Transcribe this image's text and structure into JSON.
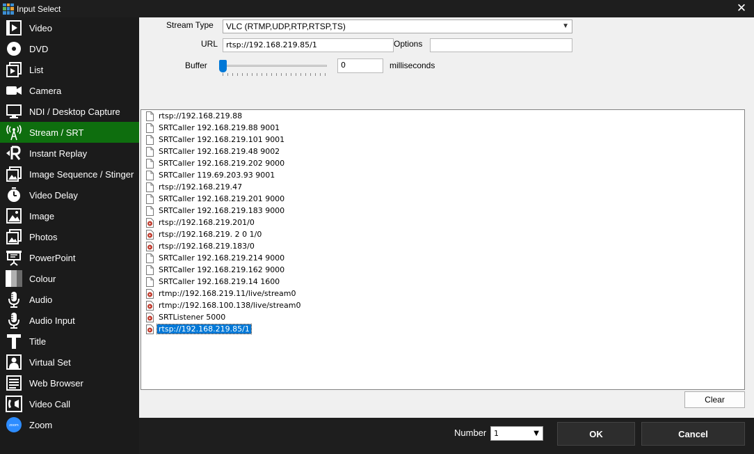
{
  "window": {
    "title": "Input Select"
  },
  "sidebar": {
    "items": [
      {
        "label": "Video",
        "icon": "video-icon"
      },
      {
        "label": "DVD",
        "icon": "dvd-icon"
      },
      {
        "label": "List",
        "icon": "list-icon"
      },
      {
        "label": "Camera",
        "icon": "camera-icon"
      },
      {
        "label": "NDI / Desktop Capture",
        "icon": "monitor-icon"
      },
      {
        "label": "Stream / SRT",
        "icon": "antenna-icon",
        "active": true
      },
      {
        "label": "Instant Replay",
        "icon": "replay-icon"
      },
      {
        "label": "Image Sequence / Stinger",
        "icon": "image-sequence-icon"
      },
      {
        "label": "Video Delay",
        "icon": "timer-icon"
      },
      {
        "label": "Image",
        "icon": "image-icon"
      },
      {
        "label": "Photos",
        "icon": "photos-icon"
      },
      {
        "label": "PowerPoint",
        "icon": "presentation-icon"
      },
      {
        "label": "Colour",
        "icon": "colour-icon"
      },
      {
        "label": "Audio",
        "icon": "microphone-icon"
      },
      {
        "label": "Audio Input",
        "icon": "microphone-icon"
      },
      {
        "label": "Title",
        "icon": "title-icon"
      },
      {
        "label": "Virtual Set",
        "icon": "virtual-set-icon"
      },
      {
        "label": "Web Browser",
        "icon": "web-browser-icon"
      },
      {
        "label": "Video Call",
        "icon": "video-call-icon"
      },
      {
        "label": "Zoom",
        "icon": "zoom-icon"
      }
    ]
  },
  "form": {
    "stream_type_label": "Stream Type",
    "stream_type_value": "VLC (RTMP,UDP,RTP,RTSP,TS)",
    "url_label": "URL",
    "url_value": "rtsp://192.168.219.85/1",
    "options_label": "Options",
    "options_value": "",
    "buffer_label": "Buffer",
    "buffer_value": "0",
    "buffer_units": "milliseconds",
    "buffer_slider_level": 0
  },
  "history": {
    "items": [
      {
        "text": "rtsp://192.168.219.88",
        "icon": "file-icon"
      },
      {
        "text": "SRTCaller 192.168.219.88 9001",
        "icon": "file-icon"
      },
      {
        "text": "SRTCaller 192.168.219.101 9001",
        "icon": "file-icon"
      },
      {
        "text": "SRTCaller 192.168.219.48 9002",
        "icon": "file-icon"
      },
      {
        "text": "SRTCaller 192.168.219.202 9000",
        "icon": "file-icon"
      },
      {
        "text": "SRTCaller 119.69.203.93 9001",
        "icon": "file-icon"
      },
      {
        "text": "rtsp://192.168.219.47",
        "icon": "file-icon"
      },
      {
        "text": "SRTCaller 192.168.219.201 9000",
        "icon": "file-icon"
      },
      {
        "text": "SRTCaller 192.168.219.183 9000",
        "icon": "file-icon"
      },
      {
        "text": "rtsp://192.168.219.201/0",
        "icon": "media-file-icon"
      },
      {
        "text": "rtsp://192.168.219. 2 0 1/0",
        "icon": "media-file-icon"
      },
      {
        "text": "rtsp://192.168.219.183/0",
        "icon": "media-file-icon"
      },
      {
        "text": "SRTCaller 192.168.219.214 9000",
        "icon": "file-icon"
      },
      {
        "text": "SRTCaller 192.168.219.162 9000",
        "icon": "file-icon"
      },
      {
        "text": "SRTCaller 192.168.219.14 1600",
        "icon": "file-icon"
      },
      {
        "text": "rtmp://192.168.219.11/live/stream0",
        "icon": "media-file-icon"
      },
      {
        "text": "rtmp://192.168.100.138/live/stream0",
        "icon": "media-file-icon"
      },
      {
        "text": "SRTListener  5000",
        "icon": "media-file-icon"
      },
      {
        "text": "rtsp://192.168.219.85/1",
        "icon": "media-file-icon",
        "selected": true
      }
    ],
    "clear_label": "Clear"
  },
  "footer": {
    "number_label": "Number",
    "number_value": "1",
    "ok_label": "OK",
    "cancel_label": "Cancel"
  }
}
